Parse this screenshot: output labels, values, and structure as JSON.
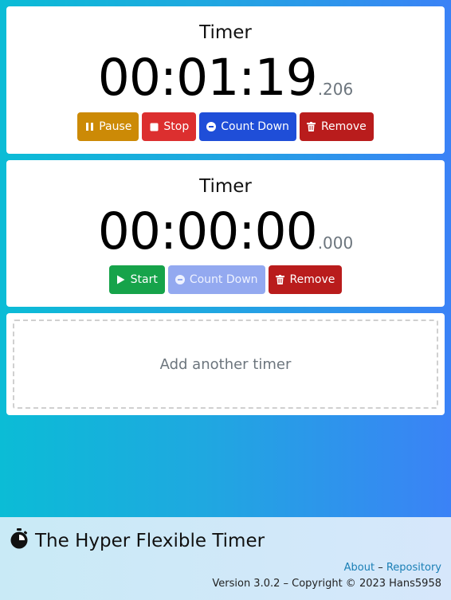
{
  "timers": [
    {
      "title": "Timer",
      "time": "00:01:19",
      "ms": ".206",
      "buttons": {
        "pause": "Pause",
        "stop": "Stop",
        "count_down": "Count Down",
        "remove": "Remove"
      }
    },
    {
      "title": "Timer",
      "time": "00:00:00",
      "ms": ".000",
      "buttons": {
        "start": "Start",
        "count_down": "Count Down",
        "remove": "Remove"
      }
    }
  ],
  "add_timer": {
    "label": "Add another timer"
  },
  "footer": {
    "brand": "The Hyper Flexible Timer",
    "about": "About",
    "separator": "–",
    "repository": "Repository",
    "version": "Version 3.0.2 – Copyright © 2023 Hans5958"
  },
  "colors": {
    "pause": "#cc8a06",
    "stop": "#dc2f2f",
    "count_down": "#1f4ed8",
    "remove": "#b91c1c",
    "start": "#16a34a",
    "count_down_disabled": "#93a9f0"
  },
  "icons": {
    "pause": "pause-icon",
    "stop": "stop-icon",
    "count_down": "minus-circle-icon",
    "remove": "trash-icon",
    "start": "play-icon",
    "brand": "stopwatch-icon"
  }
}
